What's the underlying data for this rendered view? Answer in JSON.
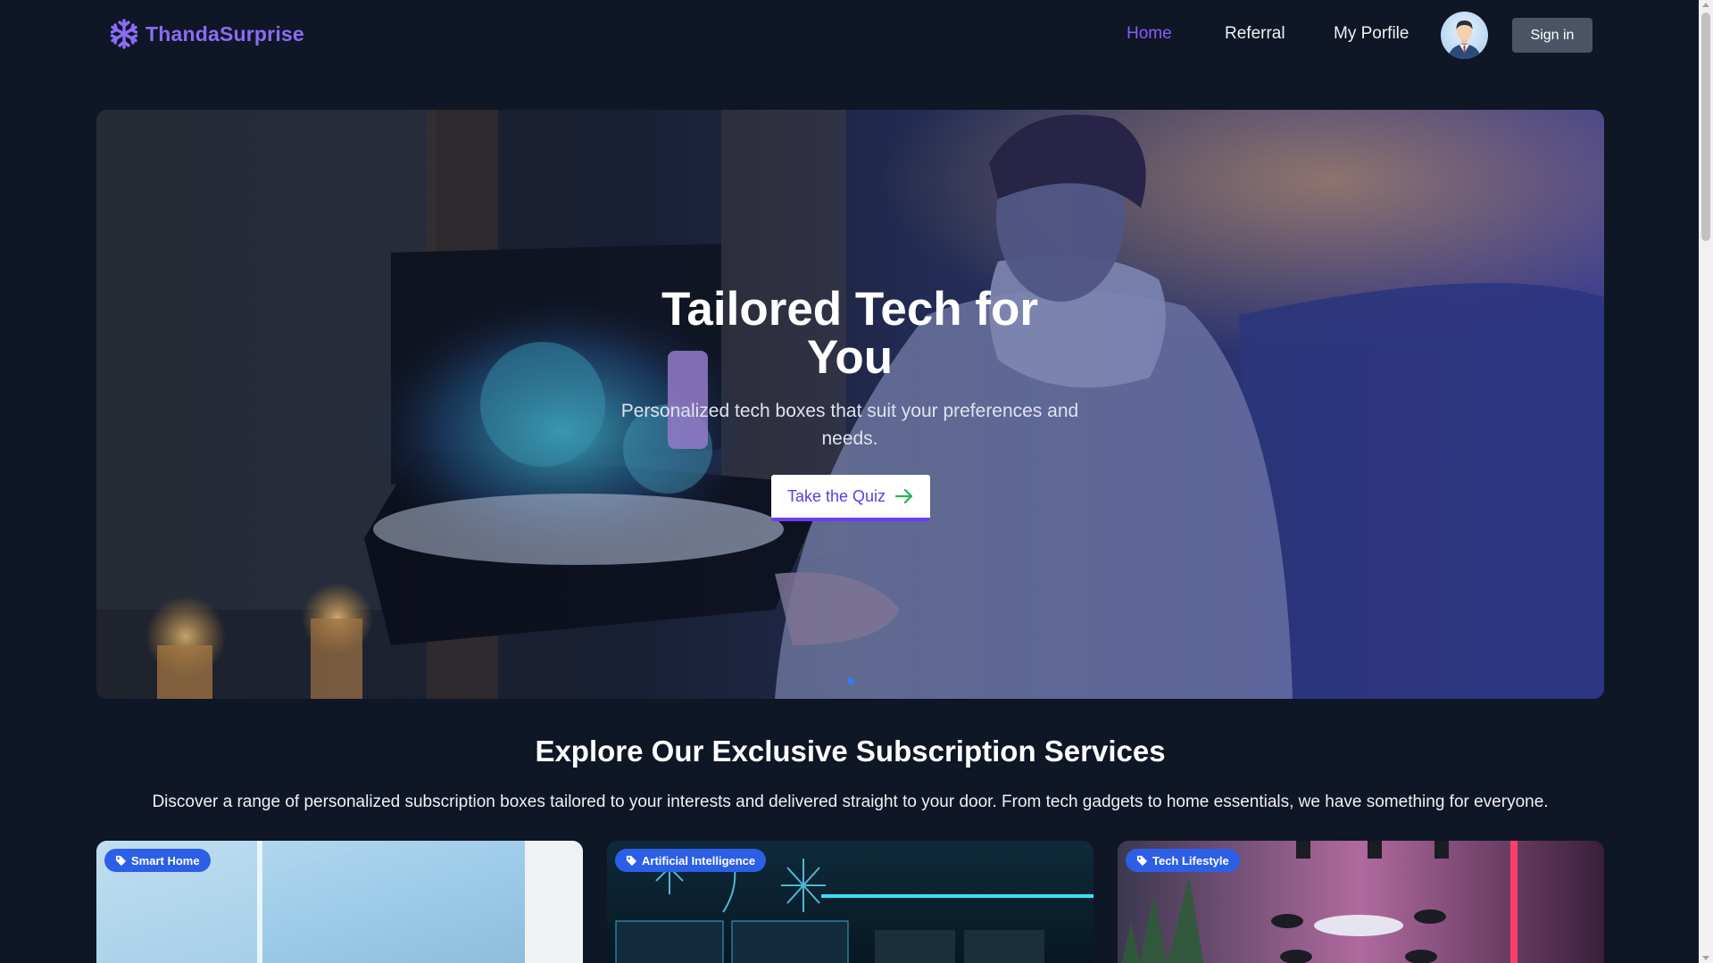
{
  "brand": {
    "name": "ThandaSurprise"
  },
  "nav": {
    "links": [
      {
        "label": "Home",
        "active": true
      },
      {
        "label": "Referral",
        "active": false
      },
      {
        "label": "My Porfile",
        "active": false
      }
    ],
    "signin_label": "Sign in"
  },
  "hero": {
    "title": "Tailored Tech for You",
    "subtitle": "Personalized tech boxes that suit your preferences and needs.",
    "cta_label": "Take the Quiz",
    "carousel_count": 1,
    "carousel_active": 0
  },
  "services": {
    "title": "Explore Our Exclusive Subscription Services",
    "description": "Discover a range of personalized subscription boxes tailored to your interests and delivered straight to your door. From tech gadgets to home essentials, we have something for everyone.",
    "cards": [
      {
        "tag": "Smart Home"
      },
      {
        "tag": "Artificial Intelligence"
      },
      {
        "tag": "Tech Lifestyle"
      }
    ]
  },
  "colors": {
    "background": "#0f1626",
    "brand": "#8b6cf3",
    "nav_active": "#8a5cf6",
    "tag_badge": "#2c5fe6",
    "cta_text": "#5b3ee0",
    "signin_bg": "#4a5465"
  },
  "icons": {
    "brand": "snowflake-icon",
    "cta": "arrow-right-icon",
    "tag": "tag-icon"
  }
}
